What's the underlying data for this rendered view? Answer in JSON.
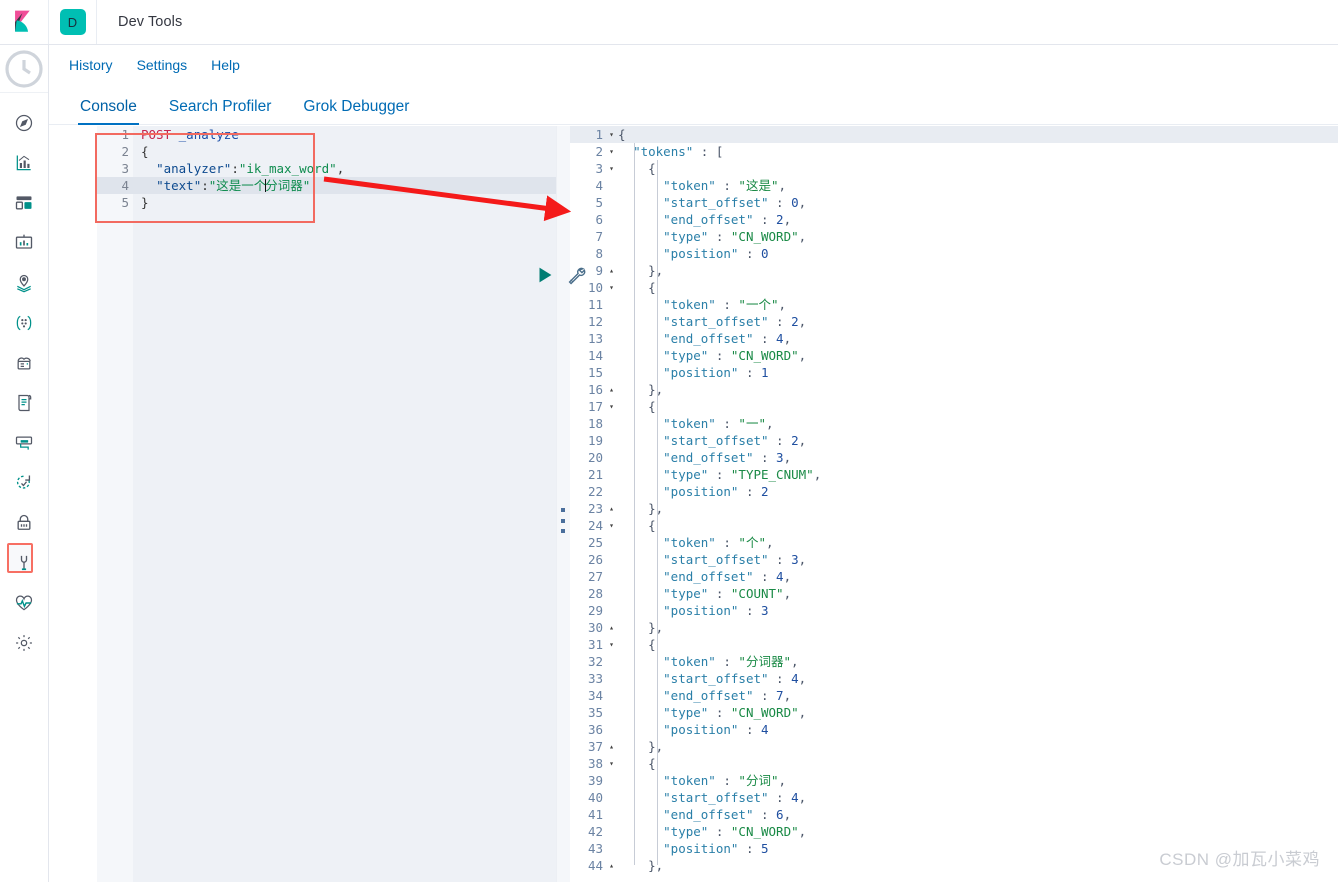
{
  "header": {
    "logo_icon": "kibana-logo",
    "app_badge_letter": "D",
    "title": "Dev Tools"
  },
  "sidebar": {
    "items": [
      {
        "icon": "recently-viewed-clock-icon",
        "active": false
      },
      {
        "icon": "discover-compass-icon",
        "active": false
      },
      {
        "icon": "visualize-chart-icon",
        "active": false
      },
      {
        "icon": "dashboard-layout-icon",
        "active": false
      },
      {
        "icon": "canvas-presentation-icon",
        "active": false
      },
      {
        "icon": "maps-location-icon",
        "active": false
      },
      {
        "icon": "machine-learning-nodes-icon",
        "active": false
      },
      {
        "icon": "infrastructure-server-icon",
        "active": false
      },
      {
        "icon": "logs-document-icon",
        "active": false
      },
      {
        "icon": "apm-monitor-icon",
        "active": false
      },
      {
        "icon": "uptime-refresh-icon",
        "active": false
      },
      {
        "icon": "siem-lock-icon",
        "active": false
      },
      {
        "icon": "dev-tools-wrench-icon",
        "active": true
      },
      {
        "icon": "monitoring-heartbeat-icon",
        "active": false
      },
      {
        "icon": "management-gear-icon",
        "active": false
      }
    ]
  },
  "subnav": {
    "links": [
      {
        "label": "History"
      },
      {
        "label": "Settings"
      },
      {
        "label": "Help"
      }
    ]
  },
  "tabs": [
    {
      "label": "Console",
      "active": true
    },
    {
      "label": "Search Profiler",
      "active": false
    },
    {
      "label": "Grok Debugger",
      "active": false
    }
  ],
  "request_editor": {
    "actions": [
      {
        "name": "send-request-play-button",
        "icon": "play-icon",
        "color": "#017d73"
      },
      {
        "name": "open-documentation-wrench-button",
        "icon": "wrench-icon",
        "color": "#4a6e8a"
      }
    ],
    "highlighted_line": 4,
    "lines": [
      {
        "n": "1",
        "fold": "",
        "text": "POST _analyze"
      },
      {
        "n": "2",
        "fold": "▾",
        "text": "{"
      },
      {
        "n": "3",
        "fold": "",
        "text": "  \"analyzer\":\"ik_max_word\","
      },
      {
        "n": "4",
        "fold": "",
        "text": "  \"text\":\"这是一个分词器\""
      },
      {
        "n": "5",
        "fold": "▴",
        "text": "}"
      }
    ]
  },
  "response_editor": {
    "lines": [
      {
        "n": "1",
        "fold": "▾",
        "text": "{"
      },
      {
        "n": "2",
        "fold": "▾",
        "text": "  \"tokens\" : ["
      },
      {
        "n": "3",
        "fold": "▾",
        "text": "    {"
      },
      {
        "n": "4",
        "fold": "",
        "text": "      \"token\" : \"这是\","
      },
      {
        "n": "5",
        "fold": "",
        "text": "      \"start_offset\" : 0,"
      },
      {
        "n": "6",
        "fold": "",
        "text": "      \"end_offset\" : 2,"
      },
      {
        "n": "7",
        "fold": "",
        "text": "      \"type\" : \"CN_WORD\","
      },
      {
        "n": "8",
        "fold": "",
        "text": "      \"position\" : 0"
      },
      {
        "n": "9",
        "fold": "▴",
        "text": "    },"
      },
      {
        "n": "10",
        "fold": "▾",
        "text": "    {"
      },
      {
        "n": "11",
        "fold": "",
        "text": "      \"token\" : \"一个\","
      },
      {
        "n": "12",
        "fold": "",
        "text": "      \"start_offset\" : 2,"
      },
      {
        "n": "13",
        "fold": "",
        "text": "      \"end_offset\" : 4,"
      },
      {
        "n": "14",
        "fold": "",
        "text": "      \"type\" : \"CN_WORD\","
      },
      {
        "n": "15",
        "fold": "",
        "text": "      \"position\" : 1"
      },
      {
        "n": "16",
        "fold": "▴",
        "text": "    },"
      },
      {
        "n": "17",
        "fold": "▾",
        "text": "    {"
      },
      {
        "n": "18",
        "fold": "",
        "text": "      \"token\" : \"一\","
      },
      {
        "n": "19",
        "fold": "",
        "text": "      \"start_offset\" : 2,"
      },
      {
        "n": "20",
        "fold": "",
        "text": "      \"end_offset\" : 3,"
      },
      {
        "n": "21",
        "fold": "",
        "text": "      \"type\" : \"TYPE_CNUM\","
      },
      {
        "n": "22",
        "fold": "",
        "text": "      \"position\" : 2"
      },
      {
        "n": "23",
        "fold": "▴",
        "text": "    },"
      },
      {
        "n": "24",
        "fold": "▾",
        "text": "    {"
      },
      {
        "n": "25",
        "fold": "",
        "text": "      \"token\" : \"个\","
      },
      {
        "n": "26",
        "fold": "",
        "text": "      \"start_offset\" : 3,"
      },
      {
        "n": "27",
        "fold": "",
        "text": "      \"end_offset\" : 4,"
      },
      {
        "n": "28",
        "fold": "",
        "text": "      \"type\" : \"COUNT\","
      },
      {
        "n": "29",
        "fold": "",
        "text": "      \"position\" : 3"
      },
      {
        "n": "30",
        "fold": "▴",
        "text": "    },"
      },
      {
        "n": "31",
        "fold": "▾",
        "text": "    {"
      },
      {
        "n": "32",
        "fold": "",
        "text": "      \"token\" : \"分词器\","
      },
      {
        "n": "33",
        "fold": "",
        "text": "      \"start_offset\" : 4,"
      },
      {
        "n": "34",
        "fold": "",
        "text": "      \"end_offset\" : 7,"
      },
      {
        "n": "35",
        "fold": "",
        "text": "      \"type\" : \"CN_WORD\","
      },
      {
        "n": "36",
        "fold": "",
        "text": "      \"position\" : 4"
      },
      {
        "n": "37",
        "fold": "▴",
        "text": "    },"
      },
      {
        "n": "38",
        "fold": "▾",
        "text": "    {"
      },
      {
        "n": "39",
        "fold": "",
        "text": "      \"token\" : \"分词\","
      },
      {
        "n": "40",
        "fold": "",
        "text": "      \"start_offset\" : 4,"
      },
      {
        "n": "41",
        "fold": "",
        "text": "      \"end_offset\" : 6,"
      },
      {
        "n": "42",
        "fold": "",
        "text": "      \"type\" : \"CN_WORD\","
      },
      {
        "n": "43",
        "fold": "",
        "text": "      \"position\" : 5"
      },
      {
        "n": "44",
        "fold": "▴",
        "text": "    },"
      }
    ]
  },
  "annotation": {
    "arrow_color": "#f41a1a",
    "box_color": "#f26a60"
  },
  "watermark": "CSDN @加瓦小菜鸡",
  "colors": {
    "accent_teal": "#00bfb3",
    "link_blue": "#006bb4",
    "tab_underline": "#0071c2",
    "play_green": "#017d73"
  }
}
